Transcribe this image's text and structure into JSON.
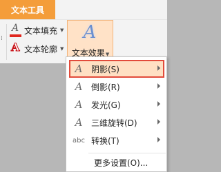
{
  "ribbon": {
    "context_tab": "文本工具",
    "fill_button": "文本填充",
    "outline_button": "文本轮廓",
    "effects_button": "文本效果"
  },
  "menu": {
    "items": [
      {
        "label": "阴影(S)",
        "icon": "shadow-a-icon",
        "has_submenu": true,
        "active": true
      },
      {
        "label": "倒影(R)",
        "icon": "reflection-a-icon",
        "has_submenu": true
      },
      {
        "label": "发光(G)",
        "icon": "glow-a-icon",
        "has_submenu": true
      },
      {
        "label": "三维旋转(D)",
        "icon": "3d-rotation-a-icon",
        "has_submenu": true
      },
      {
        "label": "转换(T)",
        "icon": "transform-abc-icon",
        "has_submenu": true
      }
    ],
    "more_settings": "更多设置(O)..."
  }
}
